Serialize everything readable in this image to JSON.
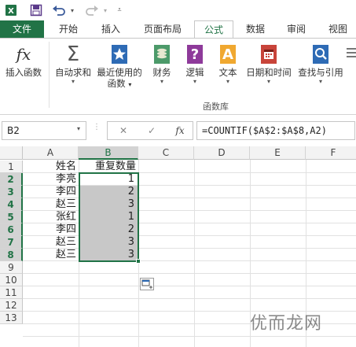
{
  "qat": {
    "save_icon": "save-icon",
    "undo_icon": "undo-icon",
    "redo_icon": "redo-icon",
    "customize_icon": "customize-qat-icon"
  },
  "tabs": [
    {
      "label": "文件"
    },
    {
      "label": "开始"
    },
    {
      "label": "插入"
    },
    {
      "label": "页面布局"
    },
    {
      "label": "公式"
    },
    {
      "label": "数据"
    },
    {
      "label": "审阅"
    },
    {
      "label": "视图"
    }
  ],
  "ribbon": {
    "buttons": [
      {
        "label": "插入函数",
        "icon": "fx-icon"
      },
      {
        "label": "自动求和",
        "icon": "sigma-icon"
      },
      {
        "label": "最近使用的函数",
        "icon": "star-book-icon"
      },
      {
        "label": "财务",
        "icon": "finance-book-icon"
      },
      {
        "label": "逻辑",
        "icon": "logic-book-icon"
      },
      {
        "label": "文本",
        "icon": "text-book-icon"
      },
      {
        "label": "日期和时间",
        "icon": "date-book-icon"
      },
      {
        "label": "查找与引用",
        "icon": "lookup-book-icon"
      }
    ],
    "recent_line1": "最近使用的",
    "recent_line2": "函数",
    "group_label": "函数库",
    "fx_glyph": "fx",
    "sigma_glyph": "Σ",
    "logic_glyph": "?",
    "text_glyph": "A"
  },
  "formula_bar": {
    "name_box": "B2",
    "cancel": "✕",
    "enter": "✓",
    "fx": "fx",
    "formula": "=COUNTIF($A$2:$A$8,A2)"
  },
  "sheet": {
    "columns": [
      "A",
      "B",
      "C",
      "D",
      "E",
      "F"
    ],
    "rows": [
      "1",
      "2",
      "3",
      "4",
      "5",
      "6",
      "7",
      "8",
      "9",
      "10",
      "11",
      "12",
      "13"
    ],
    "header_a": "姓名",
    "header_b": "重复数量",
    "names": [
      "李亮",
      "李四",
      "赵三",
      "张红",
      "李四",
      "赵三",
      "赵三"
    ],
    "counts": [
      "1",
      "2",
      "3",
      "1",
      "2",
      "3",
      "3"
    ],
    "selected_cell": "B2"
  },
  "watermark": "优而龙网",
  "colors": {
    "accent": "#217346",
    "selection_fill": "#c8c8c8"
  }
}
